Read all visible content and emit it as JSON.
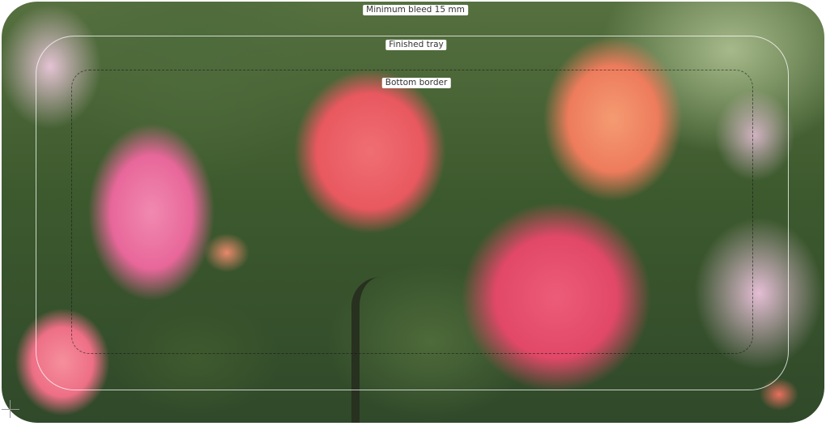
{
  "labels": {
    "bleed": "Minimum bleed 15 mm",
    "tray": "Finished tray",
    "border": "Bottom border"
  },
  "icons": {
    "crosshair": "crosshair-icon"
  }
}
